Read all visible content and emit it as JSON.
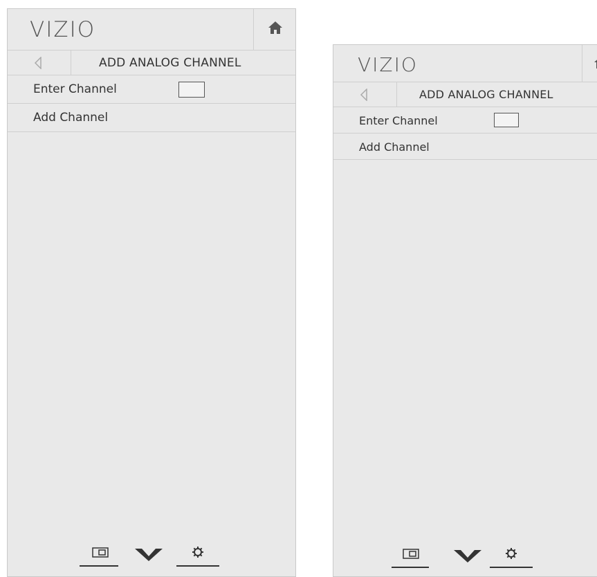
{
  "panels": [
    {
      "logo": "VIZIO",
      "nav": {
        "title": "ADD ANALOG CHANNEL"
      },
      "menu": {
        "enter_channel_label": "Enter Channel",
        "add_channel_label": "Add Channel"
      },
      "bottom_icons": [
        "input-icon",
        "vizio-v-icon",
        "gear-icon"
      ],
      "home_icon": "home-icon",
      "back_icon": "back-arrow-icon"
    },
    {
      "logo": "VIZIO",
      "nav": {
        "title": "ADD ANALOG CHANNEL"
      },
      "menu": {
        "enter_channel_label": "Enter Channel",
        "add_channel_label": "Add Channel"
      },
      "bottom_icons": [
        "input-icon",
        "vizio-v-icon",
        "gear-icon"
      ],
      "home_icon": "home-icon",
      "back_icon": "back-arrow-icon"
    }
  ],
  "colors": {
    "panel_bg": "#e9e9e9",
    "border": "#cfcfcf",
    "text": "#333333",
    "logo": "#555555"
  }
}
